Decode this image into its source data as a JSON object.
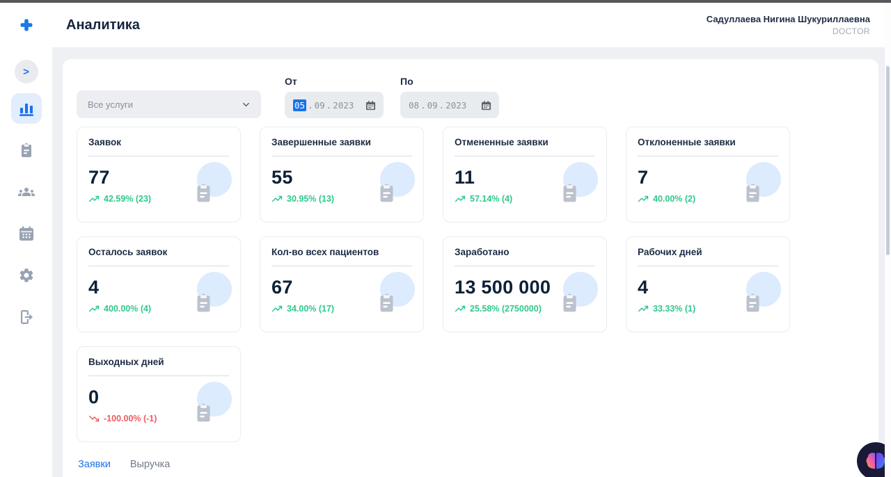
{
  "header": {
    "title": "Аналитика",
    "user_name": "Садуллаева Нигина Шукуриллаевна",
    "user_role": "DOCTOR"
  },
  "sidebar": {
    "collapse_glyph": ">"
  },
  "filters": {
    "service_select_value": "Все услуги",
    "from_label": "От",
    "to_label": "По",
    "separator": ".",
    "from_date": {
      "day": "05",
      "month": "09",
      "year": "2023"
    },
    "to_date": {
      "day": "08",
      "month": "09",
      "year": "2023"
    }
  },
  "stats_cards": [
    {
      "title": "Заявок",
      "value": "77",
      "trend": "42.59% (23)",
      "direction": "up"
    },
    {
      "title": "Завершенные заявки",
      "value": "55",
      "trend": "30.95% (13)",
      "direction": "up"
    },
    {
      "title": "Отмененные заявки",
      "value": "11",
      "trend": "57.14% (4)",
      "direction": "up"
    },
    {
      "title": "Отклоненные заявки",
      "value": "7",
      "trend": "40.00% (2)",
      "direction": "up"
    },
    {
      "title": "Осталось заявок",
      "value": "4",
      "trend": "400.00% (4)",
      "direction": "up"
    },
    {
      "title": "Кол-во всех пациентов",
      "value": "67",
      "trend": "34.00% (17)",
      "direction": "up"
    },
    {
      "title": "Заработано",
      "value": "13 500 000",
      "trend": "25.58% (2750000)",
      "direction": "up"
    },
    {
      "title": "Рабочих дней",
      "value": "4",
      "trend": "33.33% (1)",
      "direction": "up"
    },
    {
      "title": "Выходных дней",
      "value": "0",
      "trend": "-100.00% (-1)",
      "direction": "down"
    }
  ],
  "tabs": [
    {
      "label": "Заявки",
      "active": true
    },
    {
      "label": "Выручка",
      "active": false
    }
  ],
  "colors": {
    "accent": "#1a73e8",
    "positive": "#2ec98c",
    "negative": "#ee5c63",
    "highlight": "#1a73e8"
  }
}
